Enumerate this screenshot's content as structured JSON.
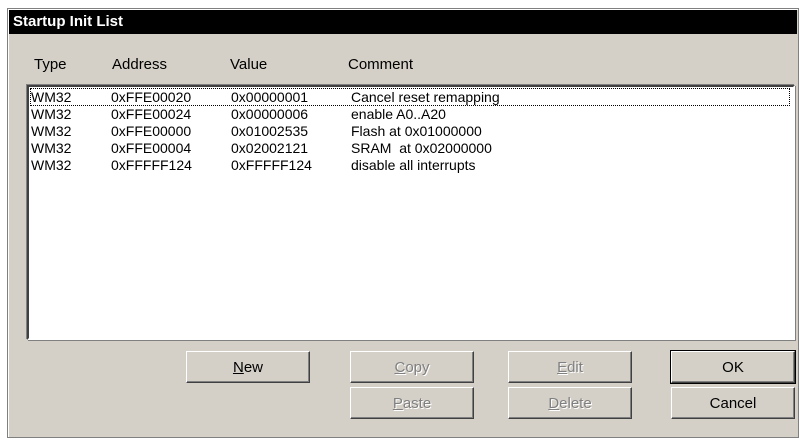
{
  "title": "Startup Init List",
  "columns": {
    "type": "Type",
    "address": "Address",
    "value": "Value",
    "comment": "Comment"
  },
  "rows": [
    {
      "type": "WM32",
      "address": "0xFFE00020",
      "value": "0x00000001",
      "comment": "Cancel reset remapping"
    },
    {
      "type": "WM32",
      "address": "0xFFE00024",
      "value": "0x00000006",
      "comment": "enable A0..A20"
    },
    {
      "type": "WM32",
      "address": "0xFFE00000",
      "value": "0x01002535",
      "comment": "Flash at 0x01000000"
    },
    {
      "type": "WM32",
      "address": "0xFFE00004",
      "value": "0x02002121",
      "comment": "SRAM  at 0x02000000"
    },
    {
      "type": "WM32",
      "address": "0xFFFFF124",
      "value": "0xFFFFF124",
      "comment": "disable all interrupts"
    }
  ],
  "buttons": {
    "new": {
      "mnemonic": "N",
      "rest": "ew"
    },
    "copy": {
      "mnemonic": "C",
      "rest": "opy"
    },
    "paste": {
      "mnemonic": "P",
      "rest": "aste"
    },
    "edit": {
      "mnemonic": "E",
      "rest": "dit"
    },
    "delete": {
      "mnemonic": "D",
      "rest": "elete"
    },
    "ok": "OK",
    "cancel": "Cancel"
  }
}
